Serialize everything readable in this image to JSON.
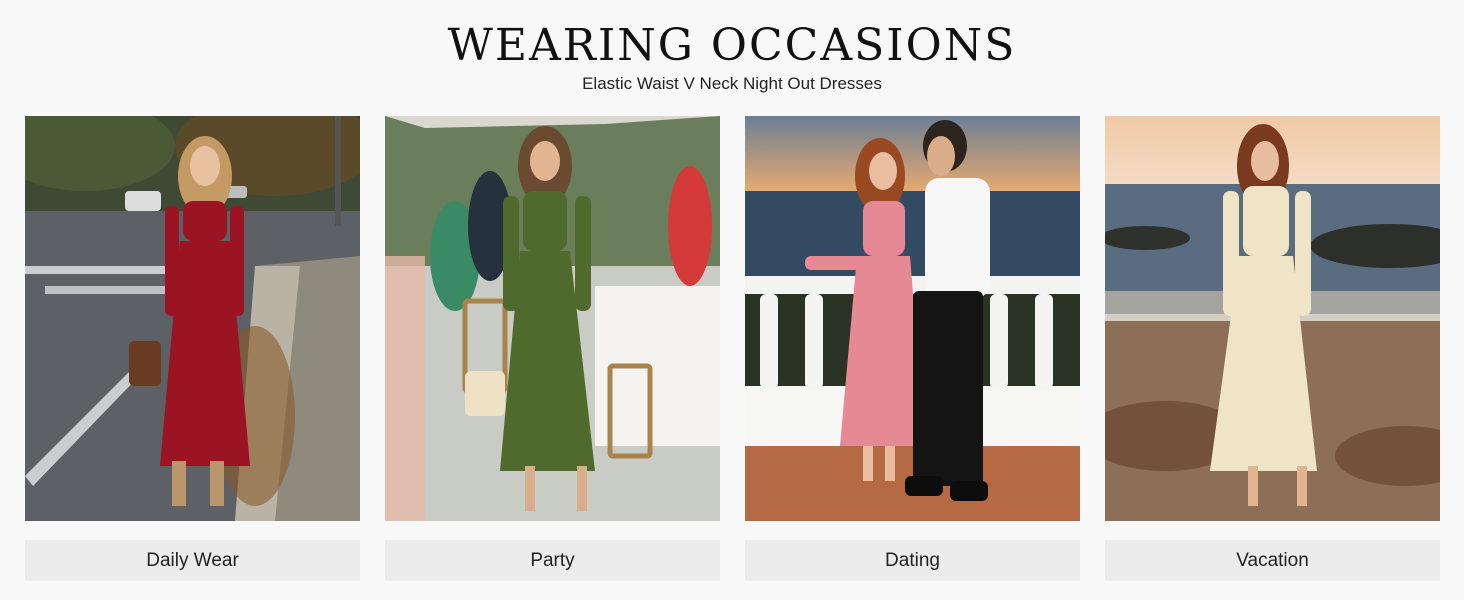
{
  "header": {
    "title": "WEARING OCCASIONS",
    "subtitle": "Elastic Waist V Neck Night Out Dresses"
  },
  "cards": [
    {
      "label": "Daily Wear",
      "dress_color": "#9b1424",
      "scene": "autumn-street"
    },
    {
      "label": "Party",
      "dress_color": "#4f6a2c",
      "scene": "outdoor-party"
    },
    {
      "label": "Dating",
      "dress_color": "#e58a95",
      "scene": "seaside-sunset-balcony"
    },
    {
      "label": "Vacation",
      "dress_color": "#efe4c6",
      "scene": "beach-sunset"
    }
  ]
}
